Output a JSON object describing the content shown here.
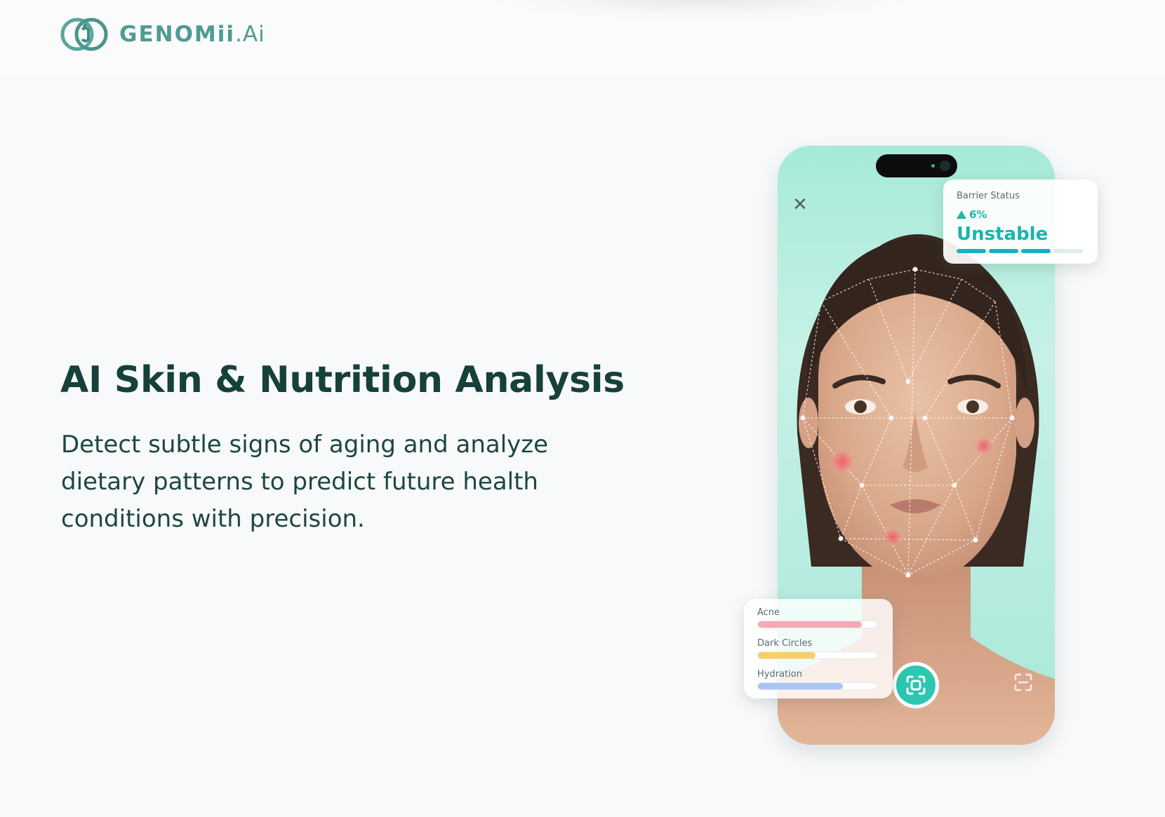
{
  "brand": {
    "name": "GENOMii",
    "suffix": ".Ai",
    "colors": {
      "primary": "#4e9b94",
      "accent": "#2cc7b0"
    }
  },
  "hero": {
    "title": "AI Skin & Nutrition Analysis",
    "subtitle": "Detect subtle signs of aging and analyze dietary patterns to predict future health conditions with precision."
  },
  "phone": {
    "icons": {
      "close": "close-icon",
      "scan": "scan-icon",
      "expand": "expand-icon"
    }
  },
  "barrier": {
    "label": "Barrier Status",
    "change": "6%",
    "status": "Unstable",
    "segments_filled": 3,
    "segments_total": 4
  },
  "metrics": [
    {
      "label": "Acne",
      "level": 0.87,
      "color": "#f4a9b4"
    },
    {
      "label": "Dark Circles",
      "level": 0.48,
      "color": "#f7cf65"
    },
    {
      "label": "Hydration",
      "level": 0.71,
      "color": "#a9c5f5"
    }
  ]
}
